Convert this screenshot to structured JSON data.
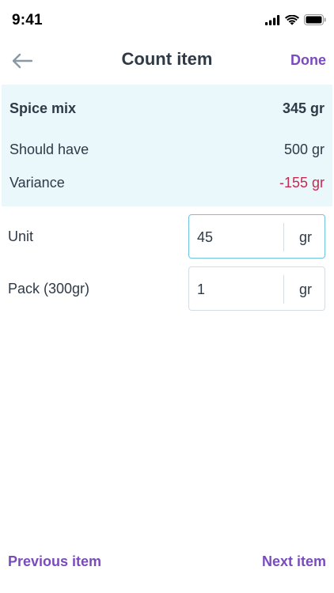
{
  "status_bar": {
    "time": "9:41"
  },
  "nav": {
    "title": "Count item",
    "done_label": "Done"
  },
  "summary": {
    "item_name": "Spice mix",
    "item_total": "345 gr",
    "should_have_label": "Should have",
    "should_have_value": "500 gr",
    "variance_label": "Variance",
    "variance_value": "-155 gr"
  },
  "counts": [
    {
      "label": "Unit",
      "value": "45",
      "unit": "gr"
    },
    {
      "label": "Pack (300gr)",
      "value": "1",
      "unit": "gr"
    }
  ],
  "footer": {
    "previous_label": "Previous item",
    "next_label": "Next item"
  },
  "colors": {
    "accent": "#7a4bbd",
    "variance": "#c8294f",
    "panel": "#eaf7fb",
    "focus_border": "#6ec3df"
  }
}
